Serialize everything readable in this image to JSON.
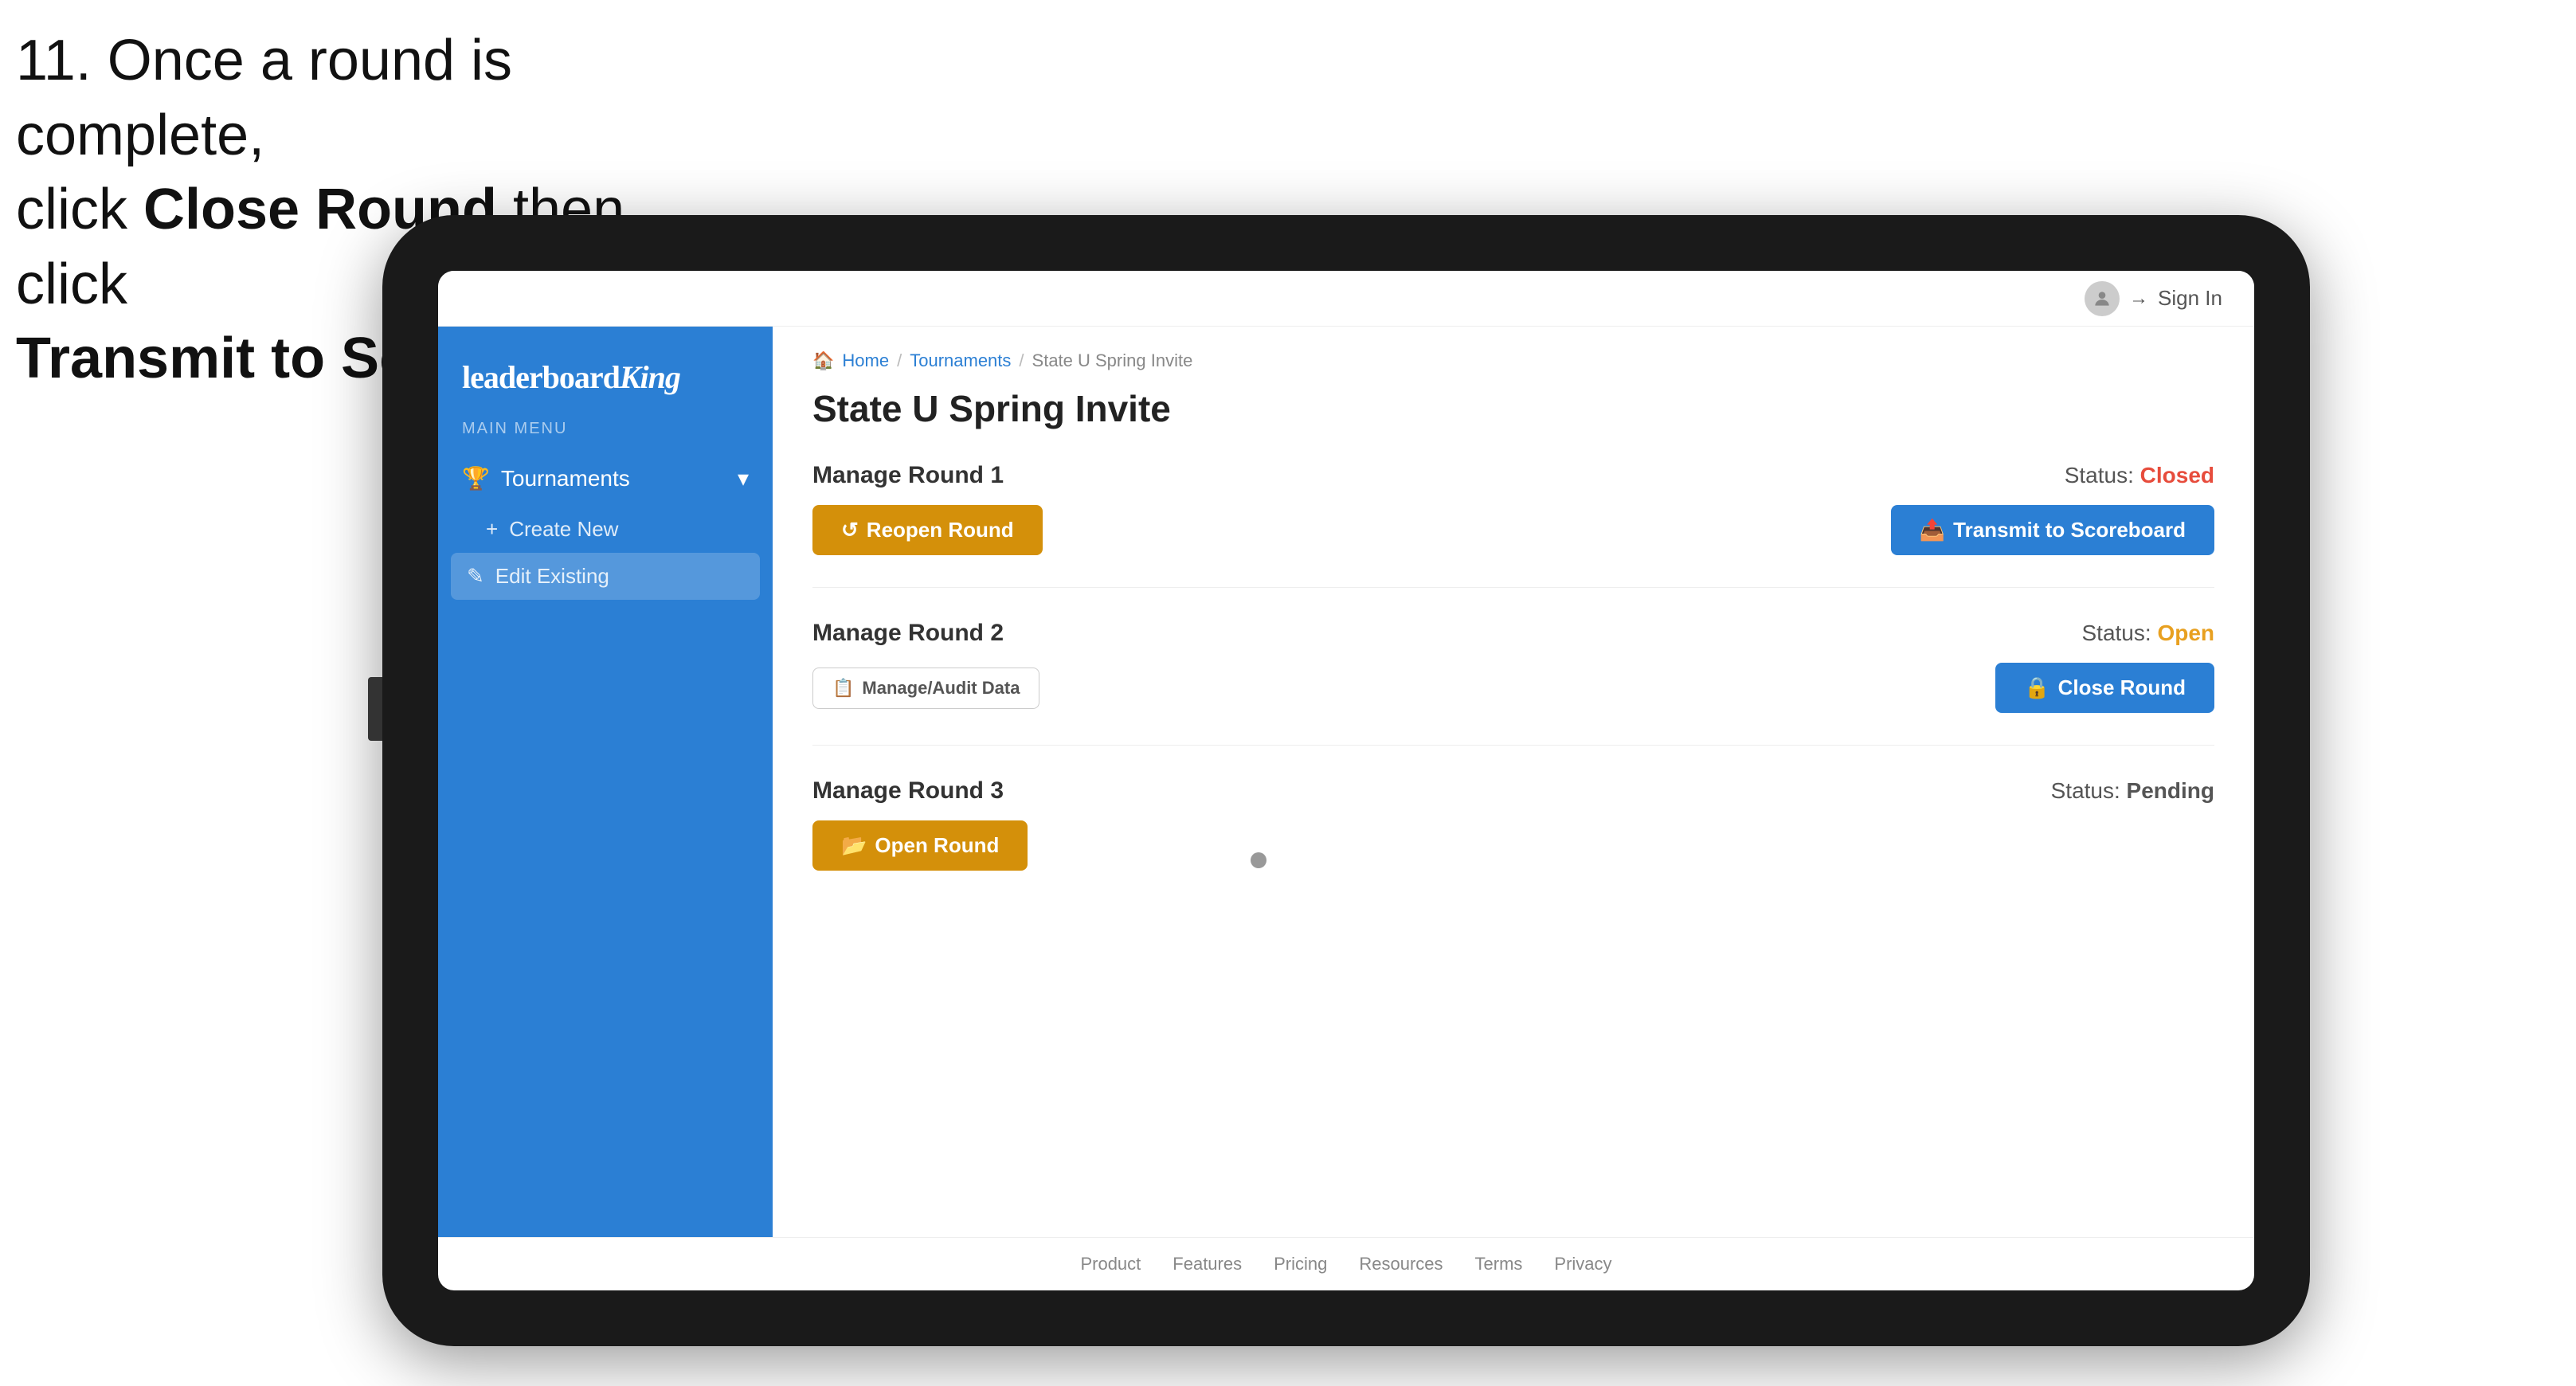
{
  "instruction": {
    "line1": "11. Once a round is complete,",
    "line2": "click ",
    "bold1": "Close Round",
    "line3": " then click",
    "bold2": "Transmit to Scoreboard."
  },
  "topbar": {
    "signin_label": "Sign In"
  },
  "sidebar": {
    "logo": "leaderboard",
    "logo_king": "King",
    "main_menu_label": "MAIN MENU",
    "tournaments_label": "Tournaments",
    "create_new_label": "Create New",
    "edit_existing_label": "Edit Existing"
  },
  "breadcrumb": {
    "home": "Home",
    "tournaments": "Tournaments",
    "current": "State U Spring Invite"
  },
  "page": {
    "title": "State U Spring Invite"
  },
  "rounds": [
    {
      "id": "round1",
      "title": "Manage Round 1",
      "status_label": "Status:",
      "status_value": "Closed",
      "status_class": "status-closed",
      "left_btn_label": "Reopen Round",
      "right_btn_label": "Transmit to Scoreboard",
      "left_btn_class": "btn-gold",
      "right_btn_class": "btn-blue"
    },
    {
      "id": "round2",
      "title": "Manage Round 2",
      "status_label": "Status:",
      "status_value": "Open",
      "status_class": "status-open",
      "left_btn_label": "Manage/Audit Data",
      "right_btn_label": "Close Round",
      "left_btn_class": "btn-outline",
      "right_btn_class": "btn-blue"
    },
    {
      "id": "round3",
      "title": "Manage Round 3",
      "status_label": "Status:",
      "status_value": "Pending",
      "status_class": "status-pending",
      "left_btn_label": "Open Round",
      "right_btn_label": "",
      "left_btn_class": "btn-gold",
      "right_btn_class": ""
    }
  ],
  "footer": {
    "links": [
      "Product",
      "Features",
      "Pricing",
      "Resources",
      "Terms",
      "Privacy"
    ]
  }
}
